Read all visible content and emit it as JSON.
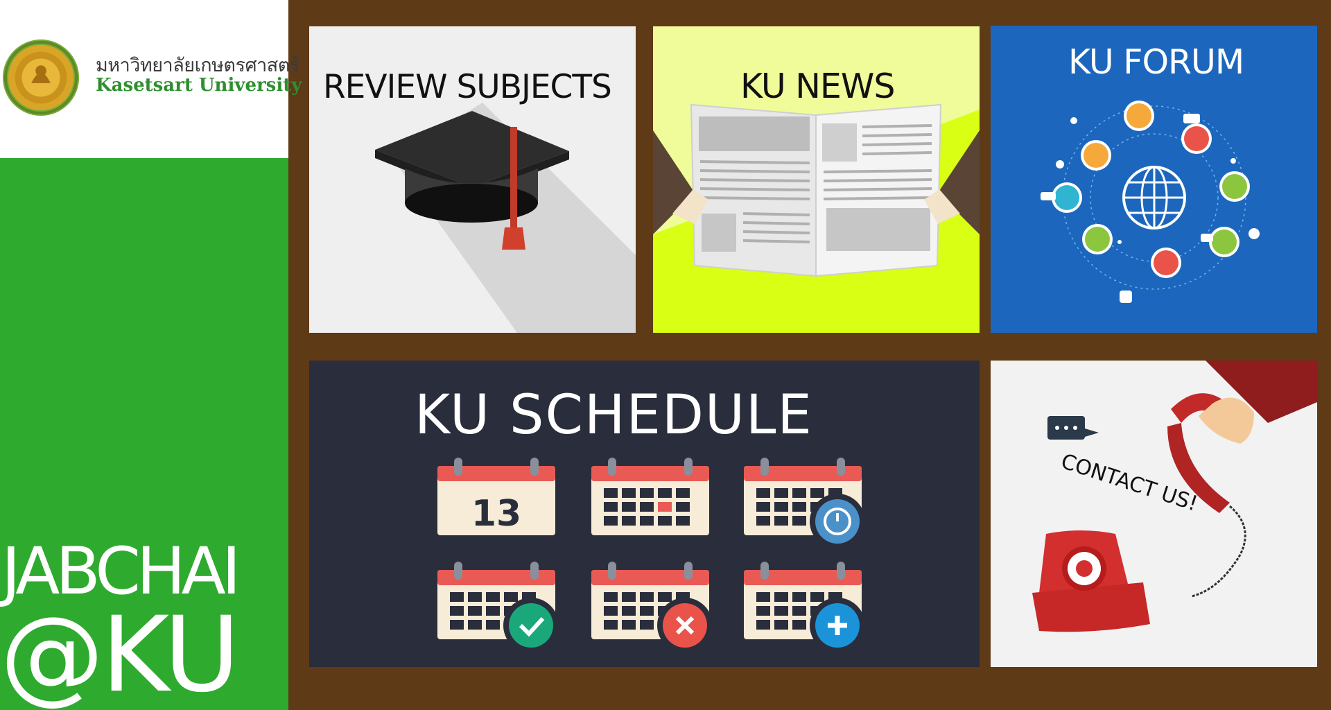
{
  "sidebar": {
    "university_thai": "มหาวิทยาลัยเกษตรศาสตร์",
    "university_en": "Kasetsart University",
    "brand_line1": "JABCHAI",
    "brand_line2": "@KU",
    "logo_icon": "university-seal-icon"
  },
  "tiles": {
    "review": {
      "title": "REVIEW SUBJECTS",
      "icon": "graduation-cap-icon"
    },
    "news": {
      "title": "KU NEWS",
      "icon": "newspaper-icon"
    },
    "forum": {
      "title": "KU FORUM",
      "icon": "social-network-globe-icon"
    },
    "schedule": {
      "title": "KU SCHEDULE",
      "calendar_day": "13",
      "icons": [
        "calendar-date-icon",
        "calendar-marked-icon",
        "calendar-timer-icon",
        "calendar-check-icon",
        "calendar-remove-icon",
        "calendar-add-icon"
      ]
    },
    "contact": {
      "title": "CONTACT US!",
      "icon": "telephone-icon"
    }
  },
  "colors": {
    "background": "#5e3a16",
    "sidebar_green": "#2eaa2e",
    "news_yellow": "#d9ff14",
    "forum_blue": "#1c67bd",
    "schedule_dark": "#2a2d3b",
    "calendar_red": "#e95a55"
  }
}
